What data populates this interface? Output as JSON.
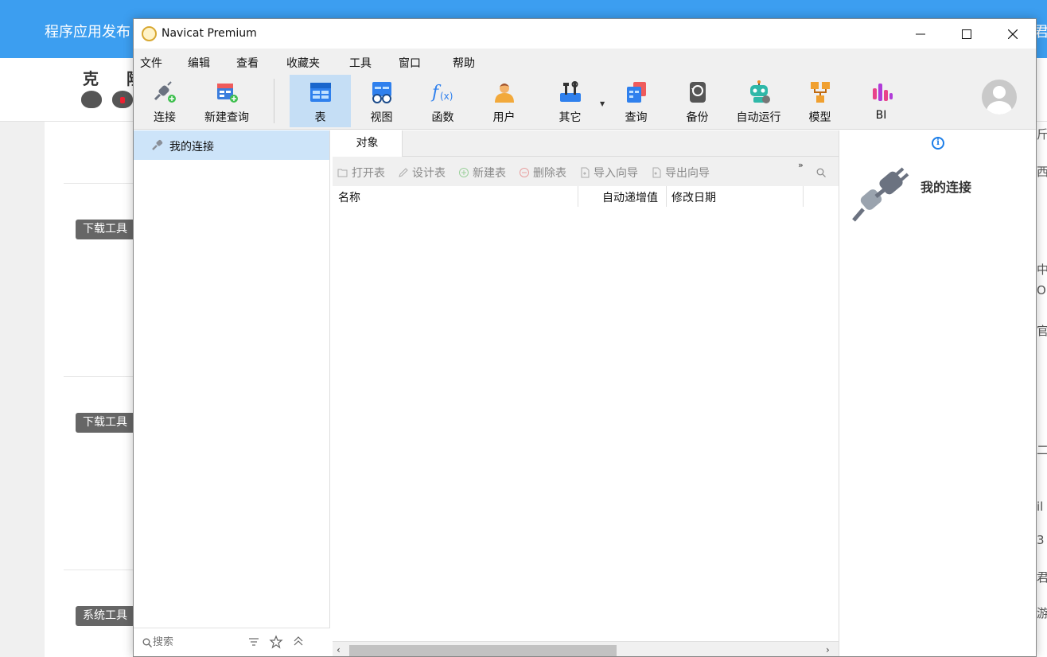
{
  "background_page": {
    "header_title": "程序应用发布",
    "header_right_fragment": "君",
    "brand_text": "克 隆",
    "badges": [
      "下载工具",
      "下载工具",
      "系统工具"
    ],
    "edge_fragments": [
      "斤",
      "西",
      "中",
      "OD",
      "官",
      "二",
      "il",
      "3",
      "君",
      "游"
    ]
  },
  "window": {
    "title": "Navicat Premium",
    "controls": {
      "minimize": "minimize",
      "maximize": "maximize",
      "close": "close"
    }
  },
  "menu": [
    "文件",
    "编辑",
    "查看",
    "收藏夹",
    "工具",
    "窗口",
    "帮助"
  ],
  "toolbar": {
    "connect": "连接",
    "new_query": "新建查询",
    "table": "表",
    "view": "视图",
    "function": "函数",
    "user": "用户",
    "other": "其它",
    "query": "查询",
    "backup": "备份",
    "automation": "自动运行",
    "model": "模型",
    "bi": "BI",
    "active": "表"
  },
  "navigator": {
    "items": [
      {
        "label": "我的连接",
        "icon": "connection-icon"
      }
    ],
    "search_placeholder": "搜索"
  },
  "objects": {
    "tab": "对象",
    "tools": [
      "打开表",
      "设计表",
      "新建表",
      "删除表",
      "导入向导",
      "导出向导"
    ],
    "more": "»",
    "columns": [
      "名称",
      "自动递增值",
      "修改日期"
    ]
  },
  "info": {
    "title": "我的连接"
  },
  "colors": {
    "accent": "#3c9ef0",
    "selection": "#cde4f9",
    "active_tool": "#c5def5",
    "link_blue": "#1c7ee8"
  }
}
